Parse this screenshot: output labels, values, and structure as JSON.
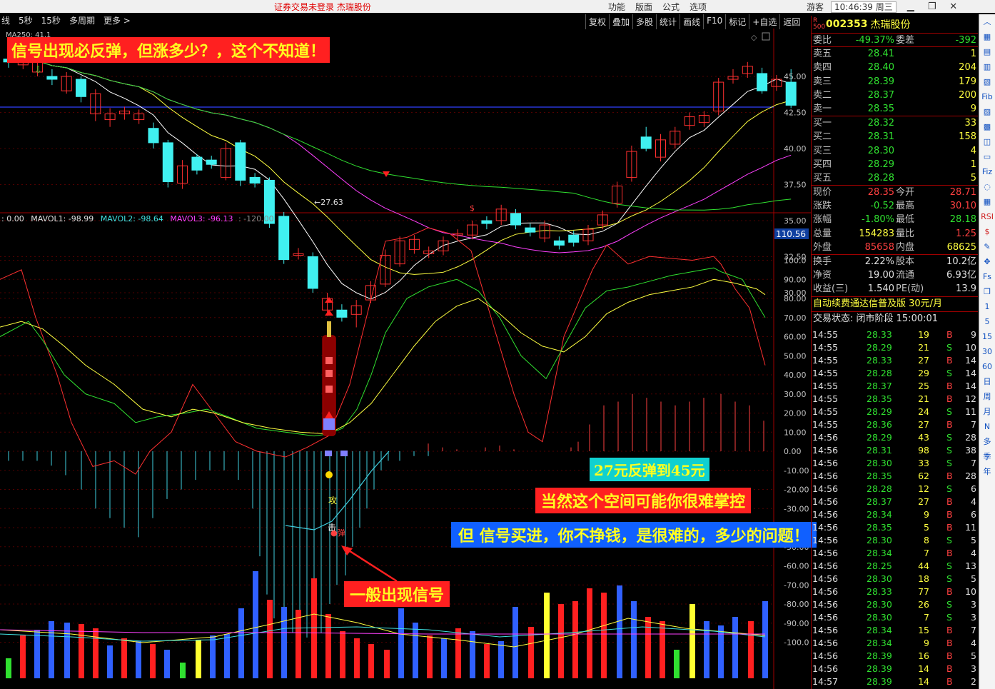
{
  "titlebar": {
    "center": "证券交易未登录  杰瑞股份",
    "menu": [
      "功能",
      "版面",
      "公式",
      "选项"
    ],
    "user": "游客",
    "time": "10:46:39 周三"
  },
  "periods": [
    "线",
    "5秒",
    "15秒",
    "多周期",
    "更多 >"
  ],
  "toolbar": [
    "复权",
    "叠加",
    "多股",
    "统计",
    "画线",
    "F10",
    "标记",
    "+自选",
    "返回"
  ],
  "price_axis": [
    "45.00",
    "42.50",
    "40.00",
    "37.50",
    "35.00",
    "32.50",
    "30.00"
  ],
  "ind_axis": [
    "100.0",
    "90.00",
    "80.00",
    "70.00",
    "60.00",
    "50.00",
    "40.00",
    "30.00",
    "20.00",
    "10.00",
    "0.00",
    "-10.00",
    "-20.00",
    "-30.00",
    "-40.00",
    "-50.00",
    "-60.00",
    "-70.00",
    "-80.00",
    "-90.00",
    "-100.0"
  ],
  "ind_value_tag": "110.56",
  "ma_label": "MA250: 41.1",
  "low_label": "←27.63",
  "vol_label": {
    "v0": ": 0.00",
    "m1": "MAVOL1: -98.99",
    "m2": "MAVOL2: -98.64",
    "m3": "MAVOL3: -96.13",
    "m4": ": -120.00"
  },
  "signals": {
    "attack": "攻",
    "strike": "击",
    "rebound": "●弹"
  },
  "banners": {
    "b1": "信号出现必反弹，但涨多少？，这个不知道！",
    "b2": "27元反弹到45元",
    "b3": "当然这个空间可能你很难掌控",
    "b4": "但  信号买进，你不挣钱，是很难的，多少的问题！",
    "b5": "一般出现信号"
  },
  "quote": {
    "code": "002353",
    "name": "杰瑞股份",
    "badge": "R 500",
    "weibi": {
      "label": "委比",
      "value": "-49.37%",
      "label2": "委差",
      "value2": "-392"
    },
    "asks": [
      {
        "label": "卖五",
        "price": "28.41",
        "vol": "1"
      },
      {
        "label": "卖四",
        "price": "28.40",
        "vol": "204"
      },
      {
        "label": "卖三",
        "price": "28.39",
        "vol": "179"
      },
      {
        "label": "卖二",
        "price": "28.37",
        "vol": "200"
      },
      {
        "label": "卖一",
        "price": "28.35",
        "vol": "9"
      }
    ],
    "bids": [
      {
        "label": "买一",
        "price": "28.32",
        "vol": "33"
      },
      {
        "label": "买二",
        "price": "28.31",
        "vol": "158"
      },
      {
        "label": "买三",
        "price": "28.30",
        "vol": "4"
      },
      {
        "label": "买四",
        "price": "28.29",
        "vol": "1"
      },
      {
        "label": "买五",
        "price": "28.28",
        "vol": "5"
      }
    ],
    "stats": [
      {
        "l1": "现价",
        "v1": "28.35",
        "l2": "今开",
        "v2": "28.71",
        "c1": "red",
        "c2": "red"
      },
      {
        "l1": "涨跌",
        "v1": "-0.52",
        "l2": "最高",
        "v2": "30.10",
        "c1": "green",
        "c2": "red"
      },
      {
        "l1": "涨幅",
        "v1": "-1.80%",
        "l2": "最低",
        "v2": "28.18",
        "c1": "green",
        "c2": "green"
      },
      {
        "l1": "总量",
        "v1": "154283",
        "l2": "量比",
        "v2": "1.25",
        "c1": "yellow",
        "c2": "red"
      },
      {
        "l1": "外盘",
        "v1": "85658",
        "l2": "内盘",
        "v2": "68625",
        "c1": "red",
        "c2": "yellow"
      }
    ],
    "stats2": [
      {
        "l1": "换手",
        "v1": "2.22%",
        "l2": "股本",
        "v2": "10.2亿"
      },
      {
        "l1": "净资",
        "v1": "19.00",
        "l2": "流通",
        "v2": "6.93亿"
      },
      {
        "l1": "收益(三)",
        "v1": "1.540",
        "l2": "PE(动)",
        "v2": "13.9"
      }
    ],
    "ad": "自动续费通达信普及版  30元/月",
    "status": "交易状态: 闭市阶段 15:00:01"
  },
  "ticks": [
    [
      "14:55",
      "28.33",
      "19",
      "B",
      "9"
    ],
    [
      "14:55",
      "28.29",
      "21",
      "S",
      "10"
    ],
    [
      "14:55",
      "28.33",
      "27",
      "B",
      "14"
    ],
    [
      "14:55",
      "28.28",
      "29",
      "S",
      "14"
    ],
    [
      "14:55",
      "28.37",
      "25",
      "B",
      "14"
    ],
    [
      "14:55",
      "28.35",
      "21",
      "B",
      "12"
    ],
    [
      "14:55",
      "28.29",
      "24",
      "S",
      "11"
    ],
    [
      "14:55",
      "28.36",
      "27",
      "B",
      "7"
    ],
    [
      "14:56",
      "28.29",
      "43",
      "S",
      "28"
    ],
    [
      "14:56",
      "28.31",
      "98",
      "S",
      "38"
    ],
    [
      "14:56",
      "28.30",
      "33",
      "S",
      "7"
    ],
    [
      "14:56",
      "28.35",
      "62",
      "B",
      "28"
    ],
    [
      "14:56",
      "28.28",
      "12",
      "S",
      "6"
    ],
    [
      "14:56",
      "28.37",
      "27",
      "B",
      "4"
    ],
    [
      "14:56",
      "28.34",
      "9",
      "B",
      "6"
    ],
    [
      "14:56",
      "28.35",
      "5",
      "B",
      "11"
    ],
    [
      "14:56",
      "28.30",
      "8",
      "S",
      "5"
    ],
    [
      "14:56",
      "28.34",
      "7",
      "B",
      "4"
    ],
    [
      "14:56",
      "28.25",
      "44",
      "S",
      "13"
    ],
    [
      "14:56",
      "28.30",
      "18",
      "S",
      "5"
    ],
    [
      "14:56",
      "28.33",
      "77",
      "B",
      "10"
    ],
    [
      "14:56",
      "28.30",
      "26",
      "S",
      "3"
    ],
    [
      "14:56",
      "28.30",
      "7",
      "S",
      "3"
    ],
    [
      "14:56",
      "28.34",
      "15",
      "B",
      "7"
    ],
    [
      "14:56",
      "28.34",
      "9",
      "B",
      "4"
    ],
    [
      "14:56",
      "28.39",
      "16",
      "B",
      "5"
    ],
    [
      "14:56",
      "28.39",
      "14",
      "B",
      "3"
    ],
    [
      "14:57",
      "28.39",
      "14",
      "B",
      "2"
    ]
  ],
  "icons": [
    "up-icon",
    "rsi-icon",
    "chart-icon",
    "dmi-icon",
    "kdj-icon",
    "fib-icon",
    "bbi-icon",
    "sar-icon",
    "cci-icon",
    "wr-icon",
    "fiz-icon",
    "roc-icon",
    "ema-icon",
    "rsi2-icon",
    "money-icon",
    "pen-icon",
    "move-icon",
    "fs-icon",
    "f5-icon",
    "1",
    "5",
    "15",
    "30",
    "60",
    "日",
    "周",
    "月",
    "N",
    "多",
    "季",
    "年"
  ],
  "chart_data": {
    "type": "candlestick",
    "candles": [
      [
        46.2,
        46.0,
        46.4,
        45.6
      ],
      [
        45.8,
        46.2,
        46.5,
        45.5
      ],
      [
        45.3,
        46.0,
        46.3,
        45.0
      ],
      [
        45.0,
        44.8,
        45.5,
        44.4
      ],
      [
        44.0,
        45.0,
        45.3,
        43.8
      ],
      [
        44.8,
        43.6,
        45.0,
        43.2
      ],
      [
        42.4,
        43.8,
        44.1,
        41.9
      ],
      [
        42.0,
        42.4,
        42.8,
        41.5
      ],
      [
        42.4,
        42.6,
        42.9,
        42.0
      ],
      [
        42.0,
        42.4,
        42.7,
        41.7
      ],
      [
        41.4,
        40.4,
        41.8,
        40.0
      ],
      [
        40.4,
        37.7,
        40.6,
        37.3
      ],
      [
        37.6,
        38.8,
        39.2,
        37.2
      ],
      [
        39.4,
        38.5,
        39.6,
        38.2
      ],
      [
        39.2,
        38.9,
        39.5,
        38.6
      ],
      [
        38.0,
        40.0,
        40.4,
        37.8
      ],
      [
        40.4,
        37.8,
        40.6,
        37.4
      ],
      [
        38.0,
        37.6,
        38.3,
        37.3
      ],
      [
        37.8,
        34.8,
        38.0,
        34.5
      ],
      [
        35.3,
        32.3,
        35.6,
        32.0
      ],
      [
        32.6,
        32.7,
        33.1,
        32.3
      ],
      [
        32.5,
        30.3,
        32.8,
        30.0
      ],
      [
        28.8,
        29.6,
        30.0,
        28.4
      ],
      [
        28.8,
        28.3,
        29.2,
        28.0
      ],
      [
        28.5,
        29.1,
        29.5,
        27.6
      ],
      [
        29.5,
        30.5,
        30.8,
        29.3
      ],
      [
        30.6,
        32.6,
        33.0,
        30.4
      ],
      [
        32.0,
        33.6,
        33.9,
        31.8
      ],
      [
        33.0,
        33.7,
        34.0,
        32.7
      ],
      [
        32.7,
        32.9,
        33.2,
        32.4
      ],
      [
        32.9,
        33.6,
        33.9,
        32.6
      ],
      [
        34.0,
        34.1,
        34.4,
        33.7
      ],
      [
        34.0,
        34.7,
        35.0,
        33.7
      ],
      [
        35.0,
        34.8,
        35.3,
        34.4
      ],
      [
        35.0,
        35.8,
        36.1,
        34.7
      ],
      [
        35.5,
        34.7,
        35.8,
        34.4
      ],
      [
        34.5,
        34.2,
        34.8,
        33.9
      ],
      [
        33.8,
        34.7,
        35.0,
        33.5
      ],
      [
        33.6,
        33.3,
        33.9,
        33.0
      ],
      [
        34.0,
        33.5,
        34.3,
        33.2
      ],
      [
        33.6,
        34.4,
        34.7,
        33.3
      ],
      [
        34.7,
        35.4,
        35.7,
        34.4
      ],
      [
        36.2,
        37.4,
        37.7,
        35.9
      ],
      [
        38.0,
        39.8,
        40.2,
        37.7
      ],
      [
        40.8,
        40.0,
        41.5,
        39.8
      ],
      [
        39.4,
        40.6,
        41.0,
        39.1
      ],
      [
        40.3,
        41.2,
        41.5,
        40.0
      ],
      [
        41.6,
        42.2,
        42.5,
        41.3
      ],
      [
        41.8,
        42.3,
        42.6,
        41.5
      ],
      [
        42.6,
        44.6,
        44.9,
        42.3
      ],
      [
        44.8,
        45.0,
        45.5,
        44.5
      ],
      [
        45.2,
        45.7,
        46.0,
        44.9
      ],
      [
        45.2,
        44.0,
        45.6,
        43.8
      ],
      [
        44.3,
        44.8,
        45.1,
        44.0
      ],
      [
        44.6,
        43.0,
        45.5,
        42.8
      ]
    ]
  }
}
